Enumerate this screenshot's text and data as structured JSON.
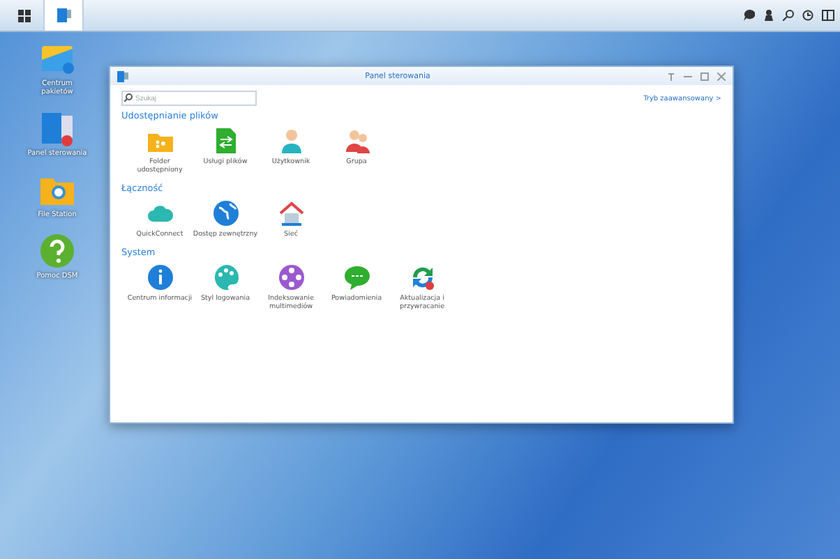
{
  "taskbar": {
    "buttons": [
      {
        "kind": "menu",
        "selected": false
      },
      {
        "kind": "panel",
        "selected": true
      }
    ]
  },
  "desktop_icons": [
    {
      "kind": "package",
      "label": "Centrum pakietów"
    },
    {
      "kind": "panel",
      "label": "Panel sterowania"
    },
    {
      "kind": "folder",
      "label": "File Station"
    },
    {
      "kind": "help",
      "label": "Pomoc DSM"
    }
  ],
  "window": {
    "title": "Panel sterowania",
    "search": {
      "placeholder": "Szukaj"
    },
    "mode_link": "Tryb zaawansowany",
    "mode_arrow": ">",
    "sections": [
      {
        "title": "Udostępnianie plików",
        "items": [
          {
            "kind": "shared-folder",
            "label": "Folder udostępniony"
          },
          {
            "kind": "file-services",
            "label": "Usługi plików"
          },
          {
            "kind": "user",
            "label": "Użytkownik"
          },
          {
            "kind": "group",
            "label": "Grupa"
          }
        ]
      },
      {
        "title": "Łączność",
        "items": [
          {
            "kind": "cloud",
            "label": "QuickConnect"
          },
          {
            "kind": "globe",
            "label": "Dostęp zewnętrzny"
          },
          {
            "kind": "network",
            "label": "Sieć"
          }
        ]
      },
      {
        "title": "System",
        "items": [
          {
            "kind": "info",
            "label": "Centrum informacji"
          },
          {
            "kind": "palette",
            "label": "Styl logowania"
          },
          {
            "kind": "media",
            "label": "Indeksowanie multimediów"
          },
          {
            "kind": "chat",
            "label": "Powiadomienia"
          },
          {
            "kind": "update",
            "label": "Aktualizacja i przywracanie"
          }
        ]
      }
    ]
  }
}
